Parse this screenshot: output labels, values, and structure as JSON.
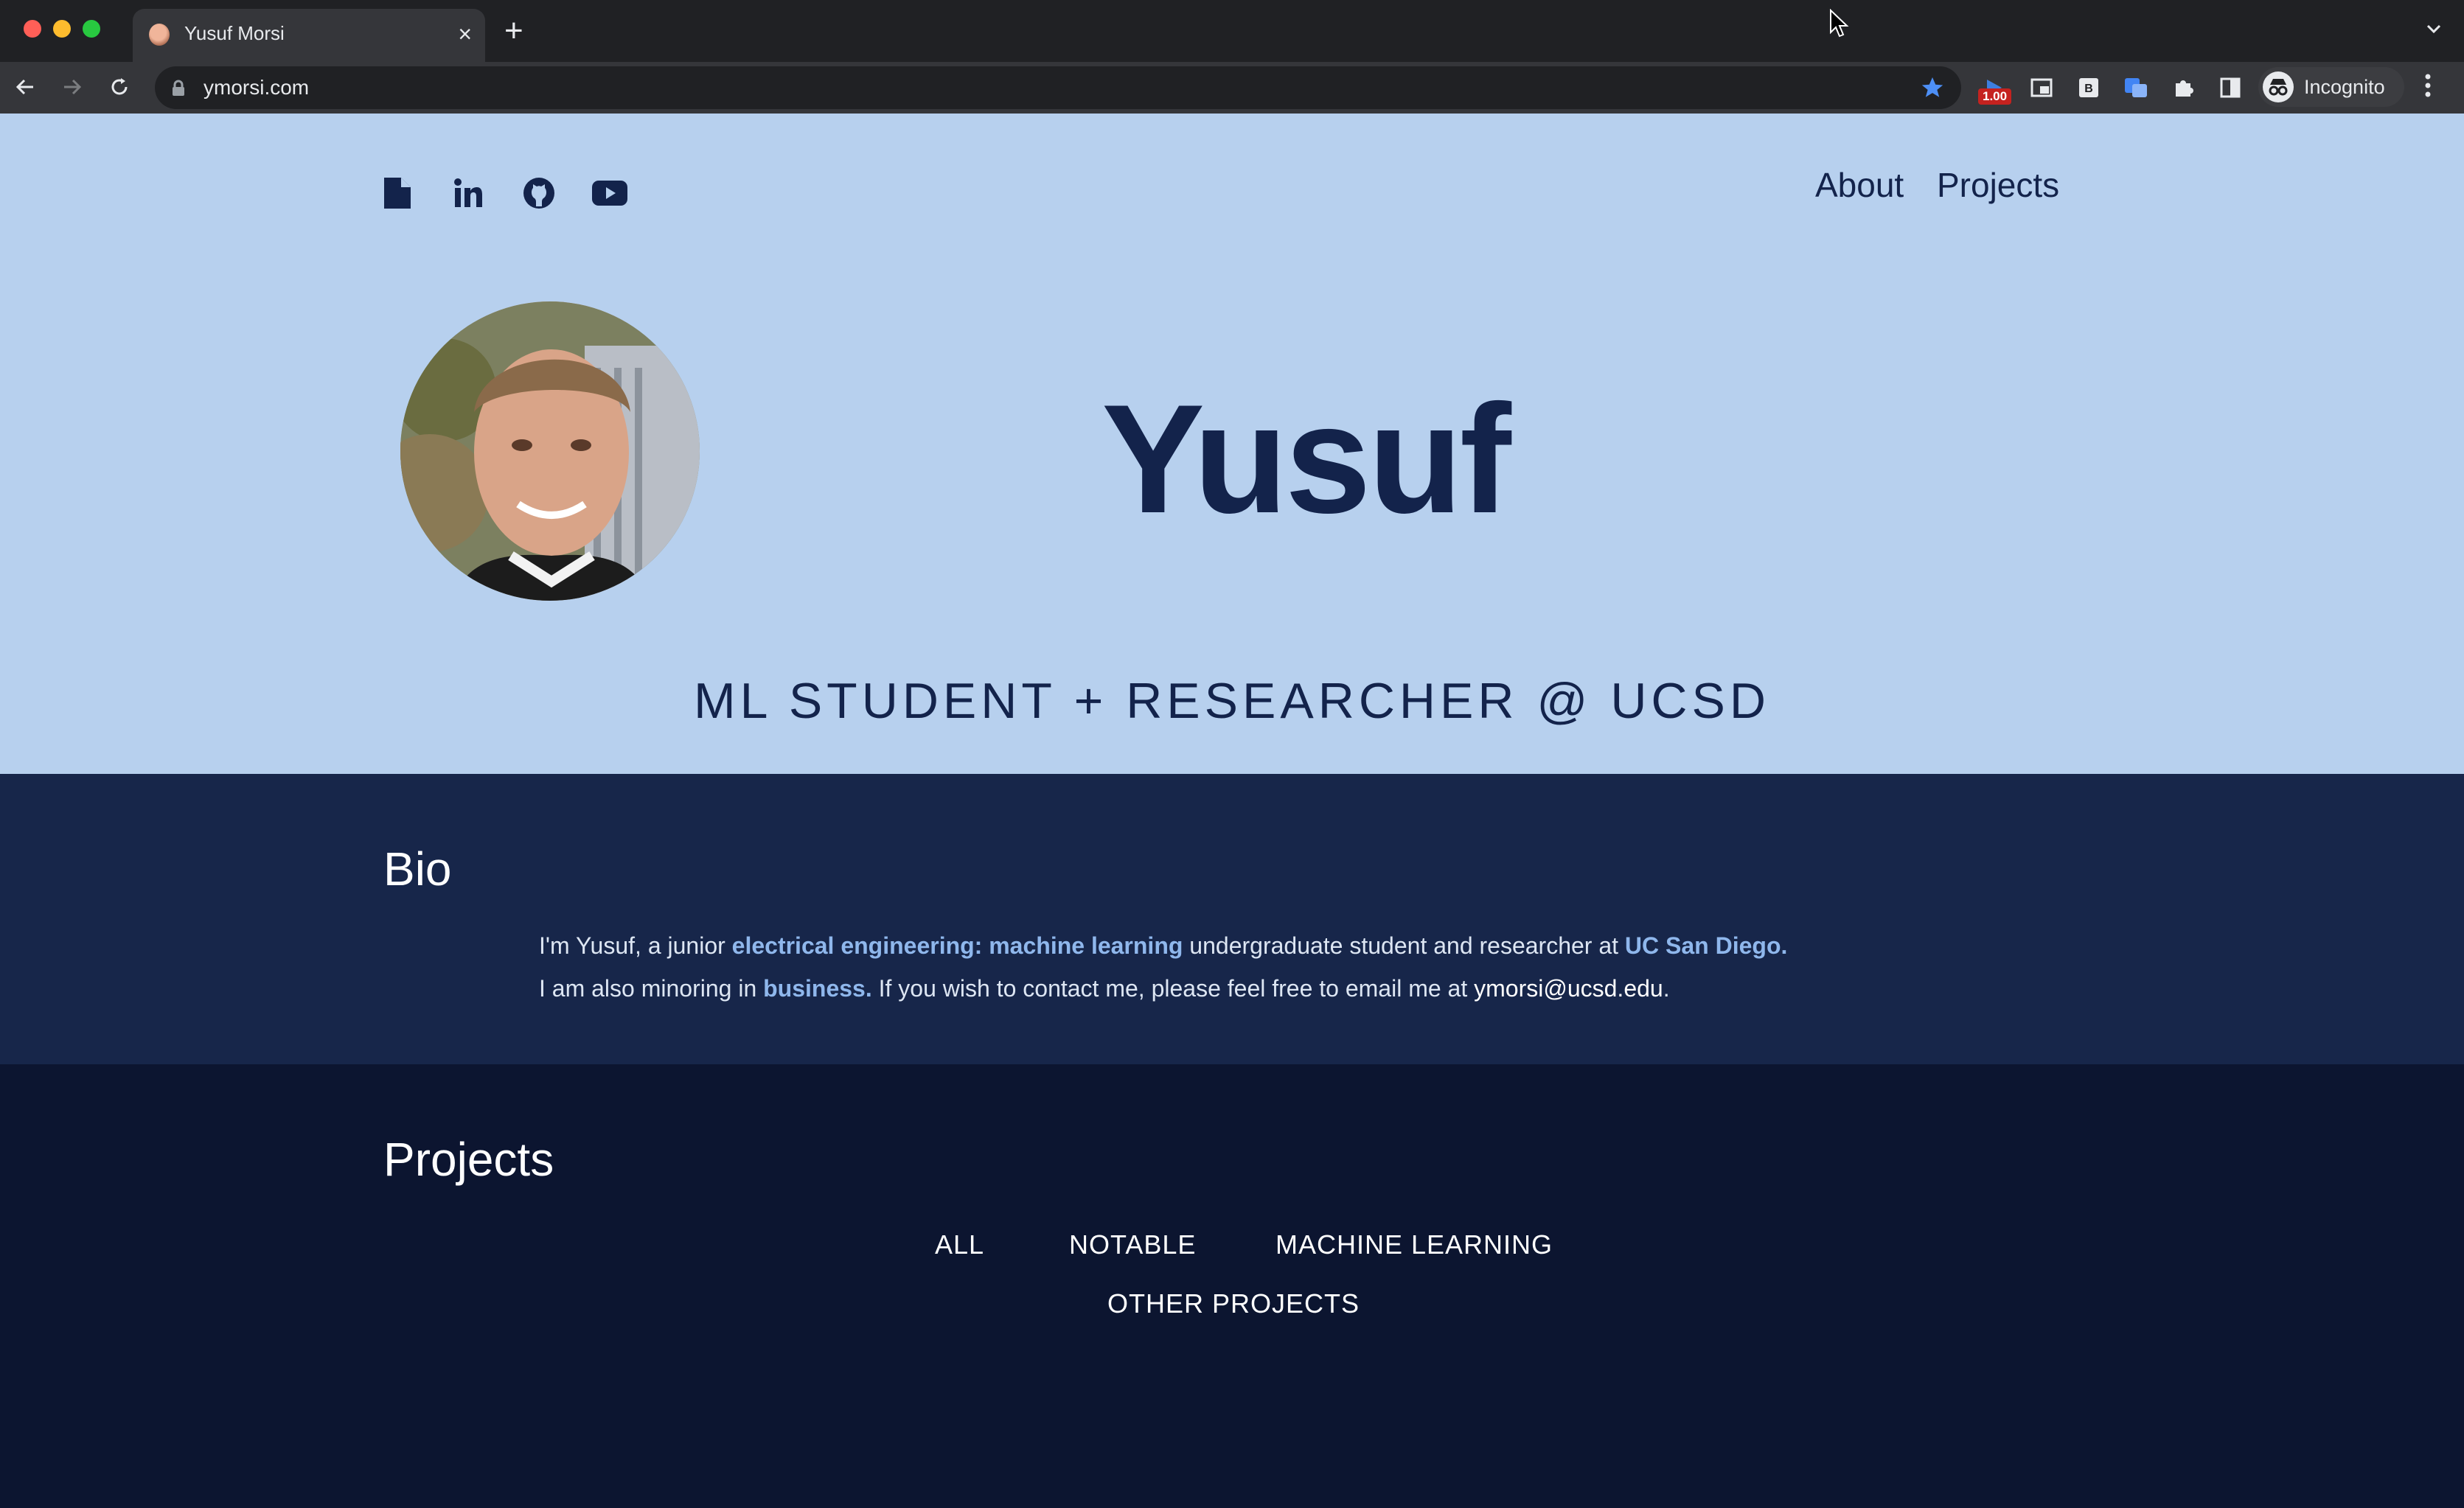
{
  "browser": {
    "tab_title": "Yusuf Morsi",
    "url": "ymorsi.com",
    "extension_badge": "1.00",
    "profile_label": "Incognito",
    "traffic_colors": [
      "#ff5f57",
      "#febc2e",
      "#28c840"
    ]
  },
  "nav": {
    "about": "About",
    "projects": "Projects"
  },
  "social_icons": [
    "resume-icon",
    "linkedin-icon",
    "github-icon",
    "youtube-icon"
  ],
  "hero": {
    "name": "Yusuf",
    "tagline": "ML STUDENT + RESEARCHER @ UCSD"
  },
  "bio": {
    "heading": "Bio",
    "line1_a": "I'm Yusuf, a junior ",
    "line1_major": "electrical engineering: machine learning",
    "line1_b": " undergraduate student and researcher at ",
    "line1_school": "UC San Diego.",
    "line2_a": "I am also minoring in ",
    "line2_minor": "business.",
    "line2_b": " If you wish to contact me, please feel free to email me at ",
    "line2_email": "ymorsi@ucsd.edu",
    "line2_c": "."
  },
  "projects": {
    "heading": "Projects",
    "filters": [
      "ALL",
      "NOTABLE",
      "MACHINE LEARNING",
      "OTHER PROJECTS"
    ]
  },
  "colors": {
    "hero_bg": "#b7d0ee",
    "bio_bg": "#17264a",
    "projects_bg": "#0c1530",
    "navy": "#13234b",
    "highlight": "#8fb7ec"
  }
}
